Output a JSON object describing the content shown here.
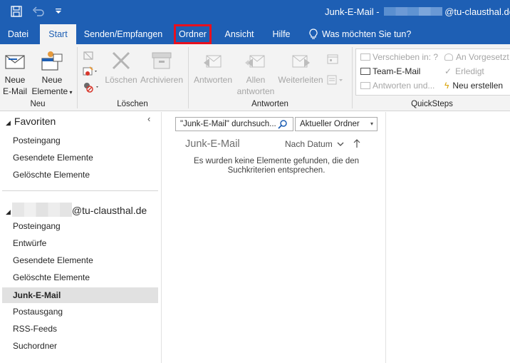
{
  "titlebar": {
    "title_prefix": "Junk-E-Mail - ",
    "title_suffix": "@tu-clausthal.de"
  },
  "tabs": [
    {
      "label": "Datei"
    },
    {
      "label": "Start"
    },
    {
      "label": "Senden/Empfangen"
    },
    {
      "label": "Ordner"
    },
    {
      "label": "Ansicht"
    },
    {
      "label": "Hilfe"
    },
    {
      "label": "Was möchten Sie tun?"
    }
  ],
  "ribbon": {
    "neu": {
      "new_email_line1": "Neue",
      "new_email_line2": "E-Mail",
      "new_items_line1": "Neue",
      "new_items_line2": "Elemente",
      "group": "Neu"
    },
    "loeschen": {
      "delete": "Löschen",
      "archive": "Archivieren",
      "group": "Löschen"
    },
    "antworten": {
      "reply": "Antworten",
      "reply_all_line1": "Allen",
      "reply_all_line2": "antworten",
      "forward": "Weiterleiten",
      "group": "Antworten"
    },
    "quicksteps": {
      "move_to": "Verschieben in: ?",
      "team_email": "Team-E-Mail",
      "reply_delete": "Antworten und...",
      "to_manager": "An Vorgesetzt",
      "done": "Erledigt",
      "create_new": "Neu erstellen",
      "group": "QuickSteps"
    }
  },
  "nav": {
    "favorites_header": "Favoriten",
    "favorites": [
      {
        "label": "Posteingang"
      },
      {
        "label": "Gesendete Elemente"
      },
      {
        "label": "Gelöschte Elemente"
      }
    ],
    "account_suffix": "@tu-clausthal.de",
    "folders": [
      {
        "label": "Posteingang"
      },
      {
        "label": "Entwürfe"
      },
      {
        "label": "Gesendete Elemente"
      },
      {
        "label": "Gelöschte Elemente"
      },
      {
        "label": "Junk-E-Mail"
      },
      {
        "label": "Postausgang"
      },
      {
        "label": "RSS-Feeds"
      },
      {
        "label": "Suchordner"
      }
    ],
    "selected_folder": "Junk-E-Mail"
  },
  "list": {
    "search_placeholder": "\"Junk-E-Mail\" durchsuch...",
    "scope": "Aktueller Ordner",
    "folder_title": "Junk-E-Mail",
    "sort_label": "Nach Datum",
    "empty_message": "Es wurden keine Elemente gefunden, die den Suchkriterien entsprechen."
  },
  "colors": {
    "accent": "#1e5fb4",
    "ribbon_bg": "#f3f3f3",
    "highlight_box": "#e8101e",
    "selected_bg": "#e1e1e1"
  },
  "icons": [
    "save-icon",
    "undo-icon",
    "customize-qat-icon",
    "new-email-icon",
    "new-items-icon",
    "ignore-icon",
    "cleanup-icon",
    "junk-icon",
    "delete-icon",
    "archive-icon",
    "reply-icon",
    "reply-all-icon",
    "forward-icon",
    "meeting-icon",
    "more-icon",
    "search-icon",
    "lightbulb-icon",
    "collapse-icon",
    "sort-up-icon"
  ]
}
